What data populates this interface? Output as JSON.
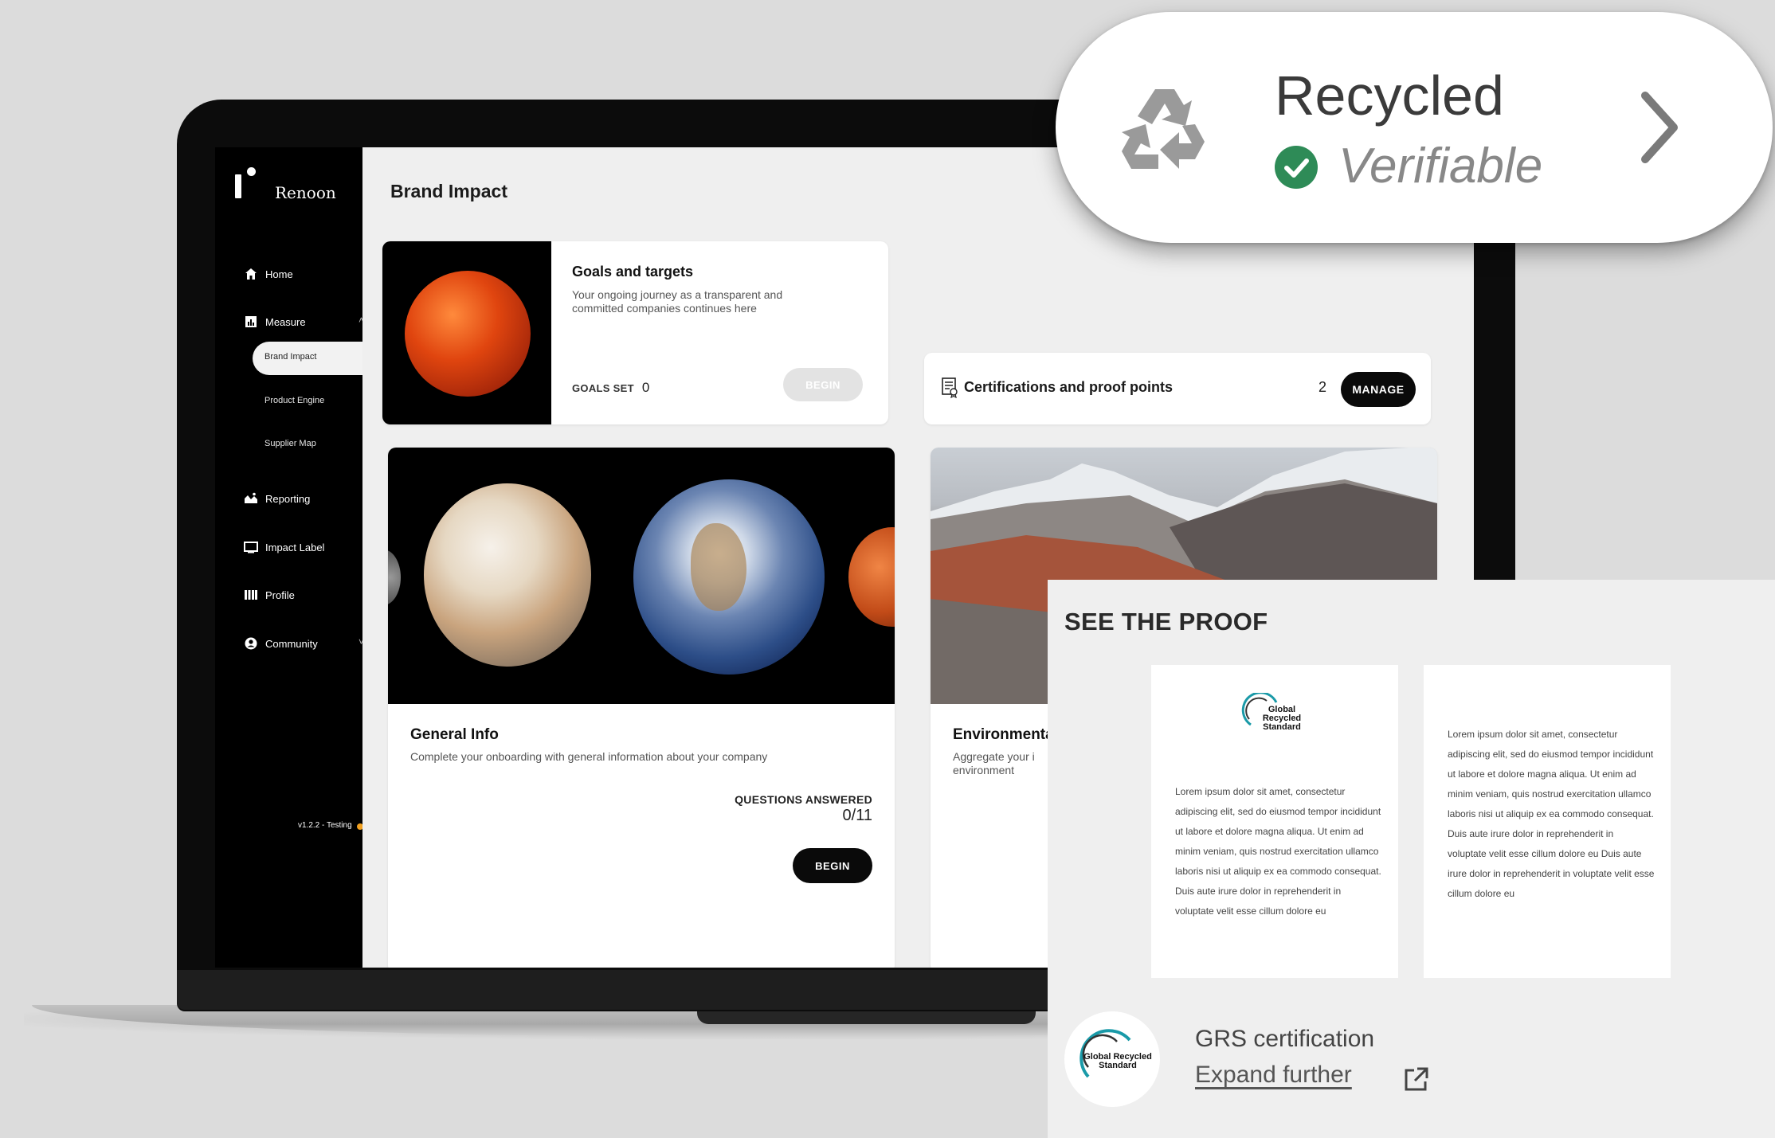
{
  "app": {
    "brand": "Renoon",
    "version": "v1.2.2 - Testing"
  },
  "sidebar": {
    "items": [
      {
        "label": "Home",
        "icon": "home-icon"
      },
      {
        "label": "Measure",
        "icon": "bar-chart-icon"
      },
      {
        "label": "Reporting",
        "icon": "reporting-icon"
      },
      {
        "label": "Impact Label",
        "icon": "monitor-icon"
      },
      {
        "label": "Profile",
        "icon": "library-icon"
      },
      {
        "label": "Community",
        "icon": "user-circle-icon"
      }
    ],
    "measure_sub": [
      "Brand Impact",
      "Product Engine",
      "Supplier Map"
    ],
    "active": "Brand Impact"
  },
  "main": {
    "title": "Brand Impact",
    "goals": {
      "title": "Goals and targets",
      "description": "Your ongoing journey as a transparent and committed companies continues here",
      "goals_set_label": "GOALS SET",
      "goals_set_value": "0",
      "button": "BEGIN"
    },
    "certifications": {
      "title": "Certifications and proof points",
      "count": "2",
      "button": "MANAGE"
    },
    "general": {
      "title": "General Info",
      "description": "Complete your onboarding with general information about your company",
      "questions_label": "QUESTIONS ANSWERED",
      "questions_value": "0/11",
      "button": "BEGIN"
    },
    "environment": {
      "title": "Environmenta",
      "description": "Aggregate your i environment"
    }
  },
  "recycled_badge": {
    "title": "Recycled",
    "subtitle": "Verifiable",
    "check_color": "#2e8b57"
  },
  "proof": {
    "title": "SEE THE PROOF",
    "logo_text": "Global Recycled Standard",
    "doc1_text": "Lorem ipsum dolor sit amet, consectetur adipiscing elit, sed do eiusmod tempor incididunt ut labore et dolore magna aliqua. Ut enim ad minim veniam, quis nostrud exercitation ullamco laboris nisi ut aliquip ex ea commodo consequat. Duis aute irure dolor in reprehenderit in voluptate velit esse cillum dolore eu",
    "doc2_text": "Lorem ipsum dolor sit amet, consectetur adipiscing elit, sed do eiusmod tempor incididunt ut labore et dolore magna aliqua. Ut enim ad minim veniam, quis nostrud exercitation ullamco laboris nisi ut aliquip ex ea commodo consequat. Duis aute irure dolor in reprehenderit in voluptate velit esse cillum dolore eu  Duis aute irure dolor in reprehenderit in voluptate velit esse cillum dolore eu",
    "certification_label": "GRS certification",
    "expand_link": "Expand further"
  }
}
